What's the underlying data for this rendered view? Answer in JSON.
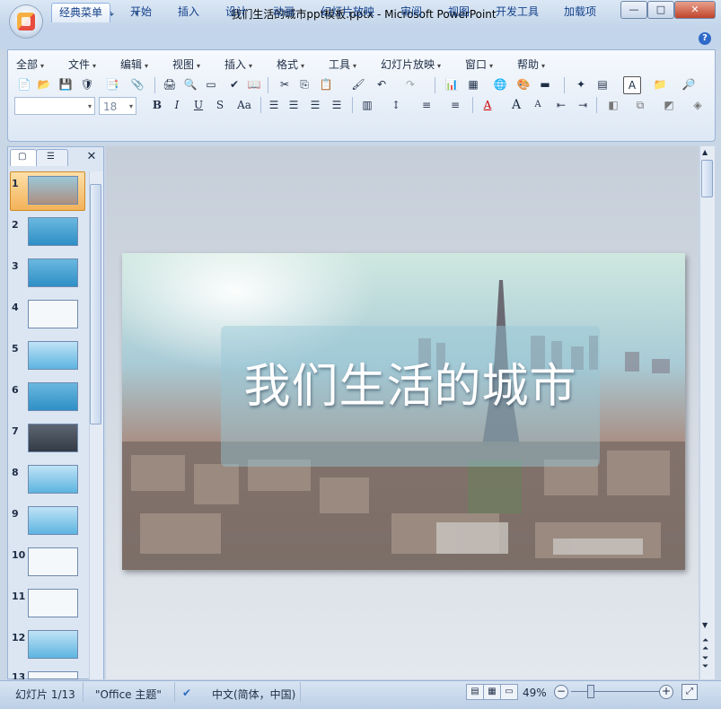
{
  "window": {
    "title": "我们生活的城市ppt模板.pptx - Microsoft PowerPoint",
    "min_label": "—",
    "max_label": "□",
    "close_label": "✕"
  },
  "quick_access": [
    "save-icon",
    "undo-icon",
    "redo-icon",
    "customize-icon"
  ],
  "tabs": [
    "经典菜单",
    "开始",
    "插入",
    "设计",
    "动画",
    "幻灯片放映",
    "审阅",
    "视图",
    "开发工具",
    "加载项"
  ],
  "active_tab": "经典菜单",
  "menus": [
    "全部",
    "文件",
    "编辑",
    "视图",
    "插入",
    "格式",
    "工具",
    "幻灯片放映",
    "窗口",
    "帮助"
  ],
  "format": {
    "font_name": "",
    "font_size": "18",
    "bold": "B",
    "italic": "I",
    "underline": "U",
    "shadow": "S",
    "change_case": "Aa",
    "grow_font": "A",
    "shrink_font": "A",
    "font_color": "A"
  },
  "slides_panel": {
    "numbers": [
      "1",
      "2",
      "3",
      "4",
      "5",
      "6",
      "7",
      "8",
      "9",
      "10",
      "11",
      "12",
      "13"
    ],
    "selected": "1"
  },
  "slide": {
    "title": "我们生活的城市"
  },
  "status": {
    "slide_indicator": "幻灯片 1/13",
    "theme": "\"Office 主题\"",
    "language": "中文(简体，中国)",
    "zoom": "49%"
  },
  "colors": {
    "accent": "#15428b",
    "ribbon_bg": "#dde8f5",
    "selection": "#f3b259"
  }
}
